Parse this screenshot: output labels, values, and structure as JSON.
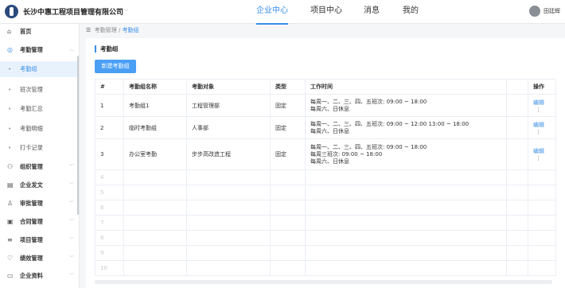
{
  "header": {
    "company": "长沙中惠工程项目管理有限公司",
    "nav": [
      "企业中心",
      "项目中心",
      "消息",
      "我的"
    ],
    "active_nav": 0,
    "username": "田廷辉"
  },
  "sidebar": {
    "items": [
      {
        "label": "首页",
        "icon": "home-icon"
      },
      {
        "label": "考勤管理",
        "icon": "check-circle-icon"
      },
      {
        "label": "考勤组",
        "sub": true,
        "active": true
      },
      {
        "label": "班次管理",
        "sub": true
      },
      {
        "label": "考勤汇总",
        "sub": true
      },
      {
        "label": "考勤明细",
        "sub": true
      },
      {
        "label": "打卡记录",
        "sub": true
      },
      {
        "label": "组织管理",
        "icon": "org-icon"
      },
      {
        "label": "企业发文",
        "icon": "doc-icon"
      },
      {
        "label": "审批管理",
        "icon": "approval-icon"
      },
      {
        "label": "合同管理",
        "icon": "contract-icon"
      },
      {
        "label": "项目管理",
        "icon": "list-icon"
      },
      {
        "label": "绩效管理",
        "icon": "performance-icon"
      },
      {
        "label": "企业资料",
        "icon": "folder-icon"
      }
    ]
  },
  "breadcrumb": {
    "parent": "考勤管理",
    "sep": "/",
    "current": "考勤组"
  },
  "main": {
    "title": "考勤组",
    "new_button": "新建考勤组",
    "columns": [
      "#",
      "考勤组名称",
      "考勤对象",
      "类型",
      "工作时间",
      "",
      "操作"
    ],
    "rows": [
      {
        "no": "1",
        "name": "考勤组1",
        "target": "工程管理部",
        "type": "固定",
        "time": [
          "每周一、二、三、四、五班次: 09:00 ~ 18:00",
          "每周六、日休息"
        ]
      },
      {
        "no": "2",
        "name": "临时考勤组",
        "target": "人事部",
        "type": "固定",
        "time": [
          "每周一、二、三、四、五班次: 09:00 ~ 12:00 13:00 ~ 18:00",
          "每周六、日休息"
        ]
      },
      {
        "no": "3",
        "name": "办公室考勤",
        "target": "步步高改造工程",
        "type": "固定",
        "time": [
          "每周一、二、三、四、五班次: 09:00 ~ 18:00",
          "每周三班次: 09:00 ~ 18:00",
          "每周六、日休息"
        ]
      }
    ],
    "edit_label": "编辑",
    "more_label": "⋮",
    "empty_rows": [
      "4",
      "5",
      "6",
      "7",
      "8",
      "9",
      "10"
    ]
  }
}
